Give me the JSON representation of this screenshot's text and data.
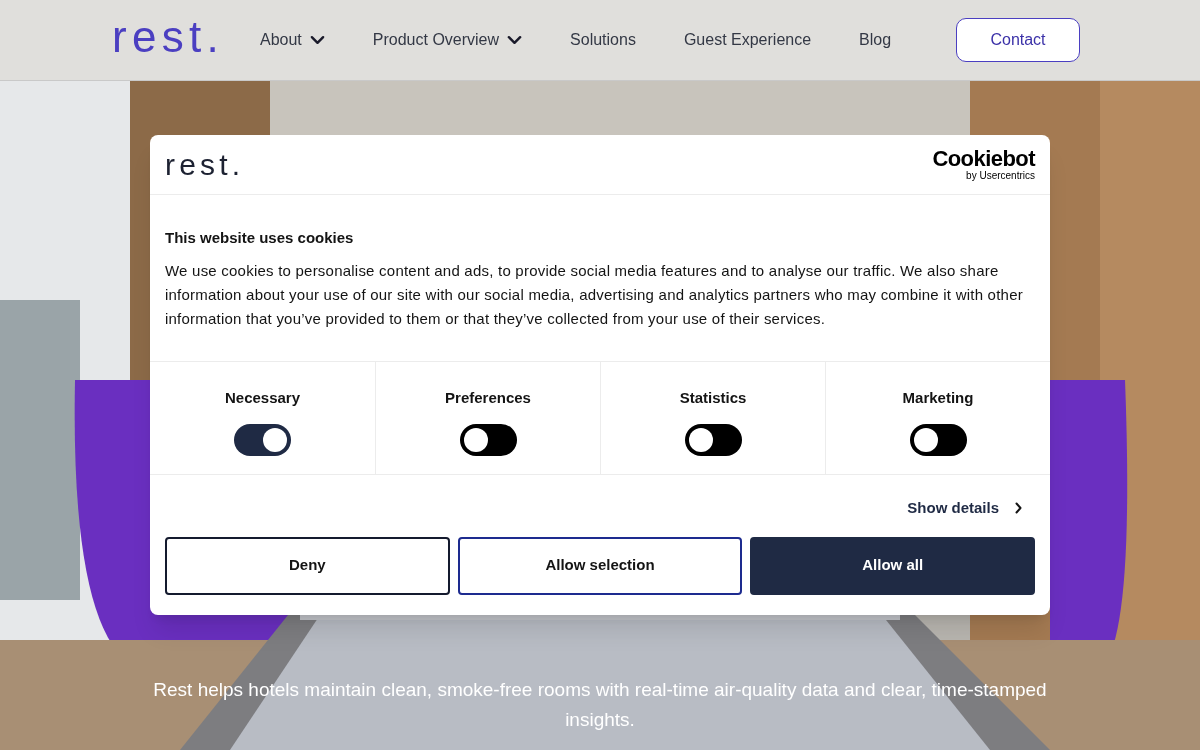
{
  "header": {
    "logo": "rest.",
    "nav": [
      {
        "label": "About",
        "dropdown": true
      },
      {
        "label": "Product Overview",
        "dropdown": true
      },
      {
        "label": "Solutions",
        "dropdown": false
      },
      {
        "label": "Guest Experience",
        "dropdown": false
      },
      {
        "label": "Blog",
        "dropdown": false
      }
    ],
    "cta": "Contact"
  },
  "hero": {
    "kind": "picture",
    "subtitle": "Rest helps hotels maintain clean, smoke-free rooms with real-time air-quality data and clear, time-stamped insights."
  },
  "cookie_dialog": {
    "logo": "rest.",
    "brand": "Cookiebot",
    "brand_sub": "by Usercentrics",
    "title": "This website uses cookies",
    "body": "We use cookies to personalise content and ads, to provide social media features and to analyse our traffic. We also share information about your use of our site with our social media, advertising and analytics partners who may combine it with other information that you’ve provided to them or that they’ve collected from your use of their services.",
    "categories": [
      {
        "label": "Necessary",
        "on": true
      },
      {
        "label": "Preferences",
        "on": false
      },
      {
        "label": "Statistics",
        "on": false
      },
      {
        "label": "Marketing",
        "on": false
      }
    ],
    "details_link": "Show details",
    "buttons": [
      {
        "label": "Deny",
        "kind": "outline"
      },
      {
        "label": "Allow selection",
        "kind": "accent"
      },
      {
        "label": "Allow all",
        "kind": "filled"
      }
    ]
  }
}
